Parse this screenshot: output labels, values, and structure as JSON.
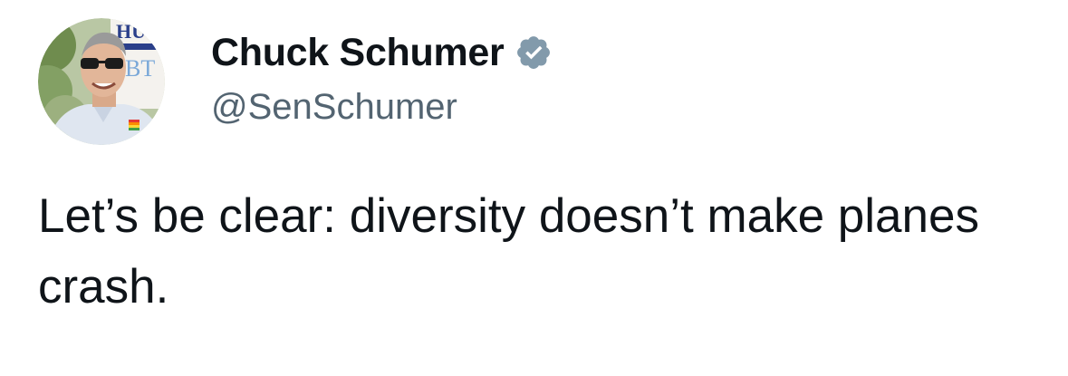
{
  "tweet": {
    "author": {
      "display_name": "Chuck Schumer",
      "handle": "@SenSchumer",
      "verified": true,
      "verified_badge_color": "#829aab"
    },
    "text": "Let’s be clear: diversity doesn’t make planes crash.",
    "avatar": {
      "banner_text_top": "HU",
      "banner_text_side": "BT"
    }
  },
  "colors": {
    "background": "#ffffff",
    "text_primary": "#0f1419",
    "text_secondary": "#536471"
  }
}
